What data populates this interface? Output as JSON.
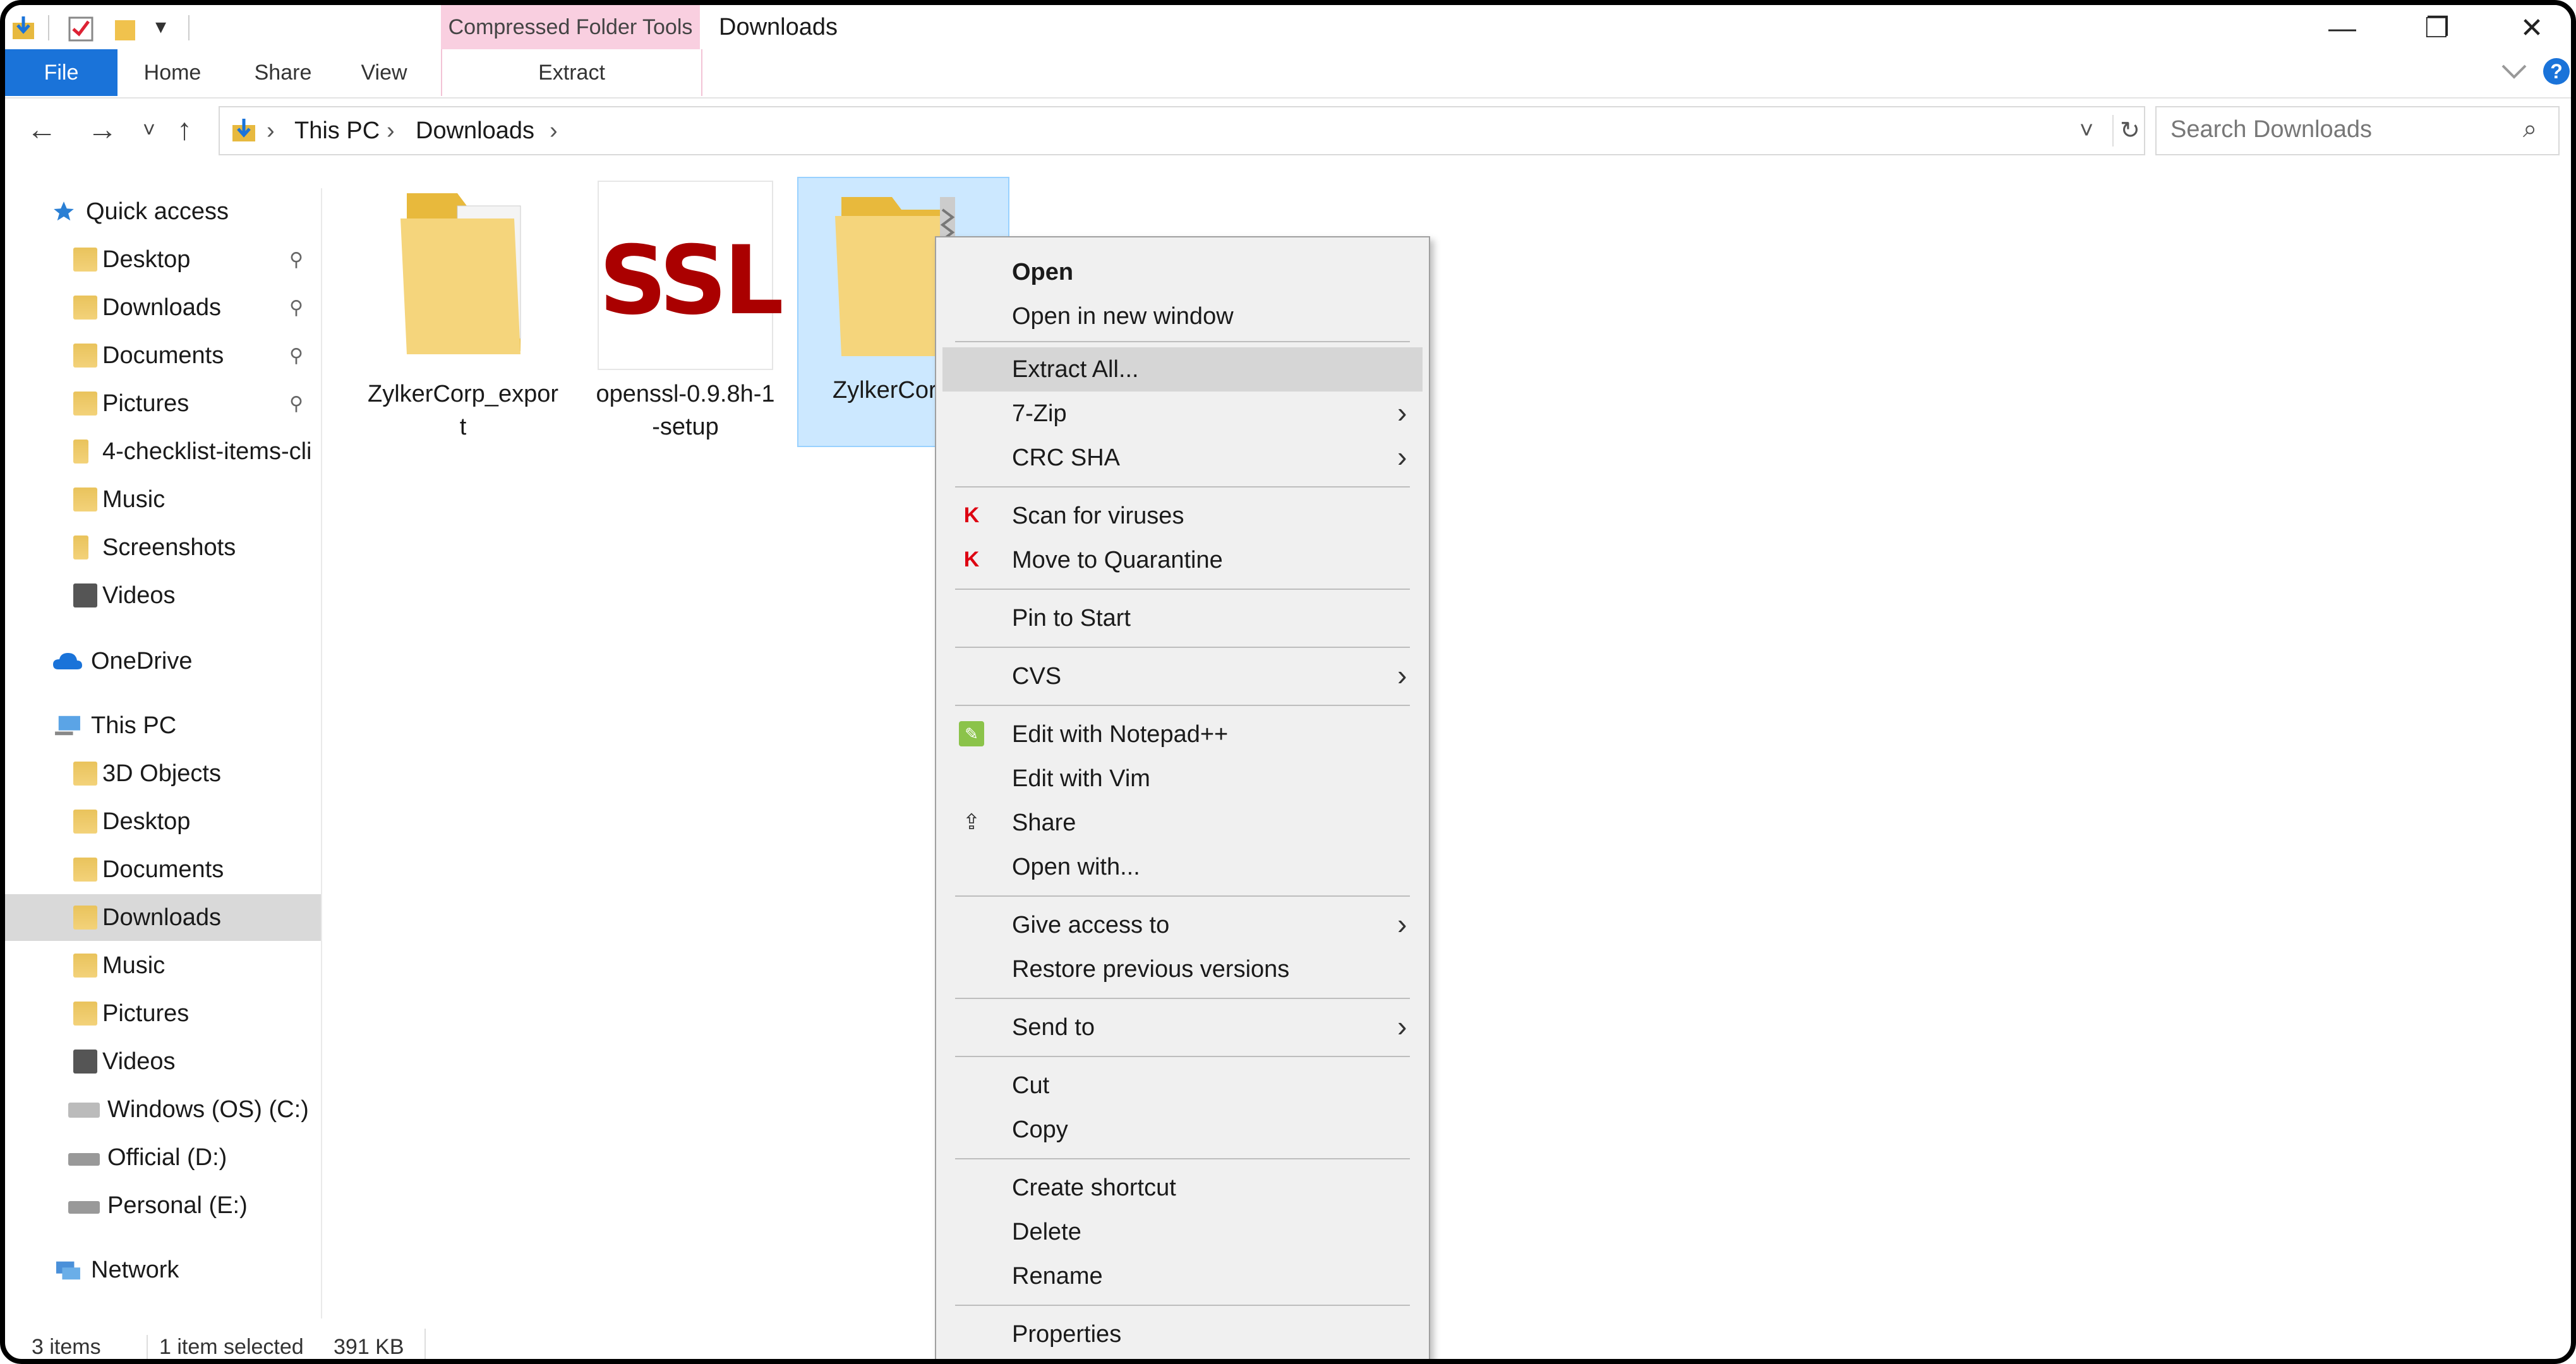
{
  "window": {
    "title": "Downloads",
    "contextual_group": "Compressed Folder Tools",
    "controls": [
      "—",
      "❐",
      "✕"
    ]
  },
  "ribbon": {
    "tabs": [
      "File",
      "Home",
      "Share",
      "View"
    ],
    "contextual_tab": "Extract",
    "expand_icon": "chevron-down-icon",
    "help_icon": "?"
  },
  "address": {
    "back": "←",
    "forward": "→",
    "recent": "˅",
    "up": "↑",
    "crumbs": [
      "This PC",
      "Downloads"
    ],
    "sep": "›",
    "dropdown": "˅",
    "refresh": "↻"
  },
  "search": {
    "placeholder": "Search Downloads",
    "icon": "⌕"
  },
  "sidebar": {
    "quick_access": "Quick access",
    "quick_items": [
      {
        "label": "Desktop",
        "pinned": true
      },
      {
        "label": "Downloads",
        "pinned": true
      },
      {
        "label": "Documents",
        "pinned": true
      },
      {
        "label": "Pictures",
        "pinned": true
      },
      {
        "label": "4-checklist-items-cli",
        "pinned": false
      },
      {
        "label": "Music",
        "pinned": false
      },
      {
        "label": "Screenshots",
        "pinned": false
      },
      {
        "label": "Videos",
        "pinned": false
      }
    ],
    "onedrive": "OneDrive",
    "this_pc": "This PC",
    "pc_items": [
      "3D Objects",
      "Desktop",
      "Documents",
      "Downloads",
      "Music",
      "Pictures",
      "Videos",
      "Windows (OS) (C:)",
      "Official (D:)",
      "Personal (E:)"
    ],
    "network": "Network",
    "pin_glyph": "📌"
  },
  "files": [
    {
      "name": "ZylkerCorp_expor\nt",
      "type": "folder"
    },
    {
      "name": "openssl-0.9.8h-1\n-setup",
      "type": "ssl",
      "icon_text": "SSL"
    },
    {
      "name": "ZylkerCorp_\nt",
      "type": "zip"
    }
  ],
  "menu": {
    "items": [
      {
        "label": "Open",
        "bold": true
      },
      {
        "label": "Open in new window"
      },
      {
        "label": "Extract All...",
        "highlight": true
      },
      {
        "label": "7-Zip",
        "submenu": true
      },
      {
        "label": "CRC SHA",
        "submenu": true
      },
      {
        "label": "Scan for viruses",
        "icon": "kaspersky-icon"
      },
      {
        "label": "Move to Quarantine",
        "icon": "kaspersky-icon"
      },
      {
        "label": "Pin to Start"
      },
      {
        "label": "CVS",
        "submenu": true
      },
      {
        "label": "Edit with Notepad++",
        "icon": "notepad-plus-plus-icon"
      },
      {
        "label": "Edit with Vim"
      },
      {
        "label": "Share",
        "icon": "share-icon"
      },
      {
        "label": "Open with..."
      },
      {
        "label": "Give access to",
        "submenu": true
      },
      {
        "label": "Restore previous versions"
      },
      {
        "label": "Send to",
        "submenu": true
      },
      {
        "label": "Cut"
      },
      {
        "label": "Copy"
      },
      {
        "label": "Create shortcut"
      },
      {
        "label": "Delete"
      },
      {
        "label": "Rename"
      },
      {
        "label": "Properties"
      }
    ],
    "arrow": "›"
  },
  "status": {
    "count": "3 items",
    "selected": "1 item selected",
    "size": "391 KB"
  },
  "colors": {
    "file_tab": "#1a73d9",
    "contextual_tab": "#f9cfe0",
    "selection": "#cce8ff",
    "menu_bg": "#f0f0f0",
    "menu_highlight": "#d6d6d6"
  }
}
